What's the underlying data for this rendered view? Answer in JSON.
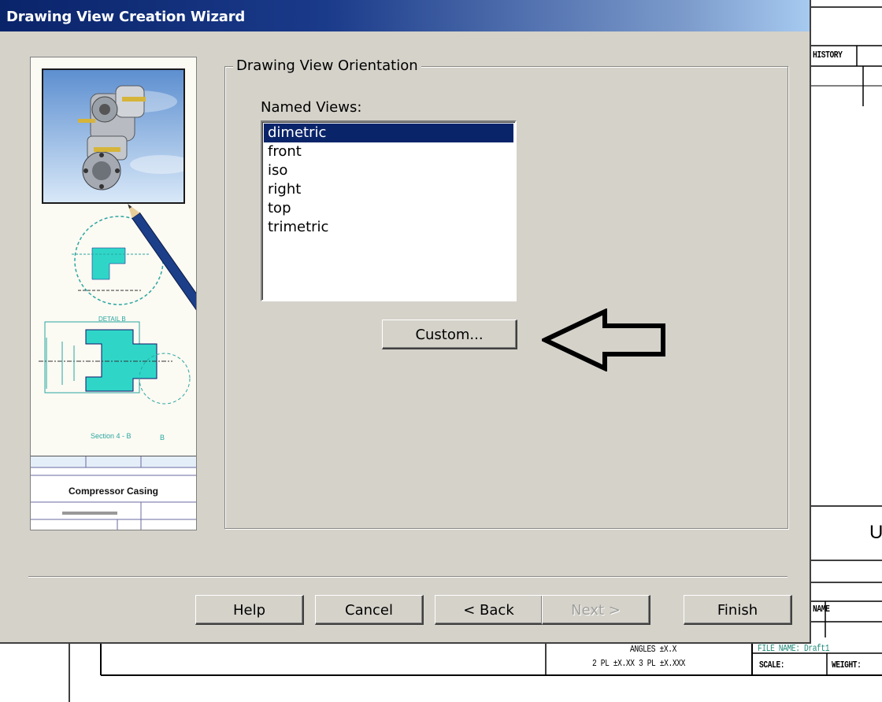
{
  "window": {
    "title": "Drawing View Creation Wizard"
  },
  "illustration": {
    "detail_label": "DETAIL B",
    "section_label": "Section 4 - B",
    "section_letter": "B",
    "titleblock_title": "Compressor Casing"
  },
  "group": {
    "legend": "Drawing View Orientation",
    "named_views_label": "Named Views:",
    "views": [
      "dimetric",
      "front",
      "iso",
      "right",
      "top",
      "trimetric"
    ],
    "selected": "dimetric",
    "custom_button": "Custom..."
  },
  "buttons": {
    "help": "Help",
    "cancel": "Cancel",
    "back": "< Back",
    "next": "Next >",
    "finish": "Finish"
  },
  "background_sheet": {
    "history": "HISTORY",
    "letter_u": "U",
    "name": "NAME",
    "angles": "ANGLES ±X.X",
    "tolerance": "2 PL ±X.XX 3 PL ±X.XXX",
    "file_name": "FILE NAME: Draft1",
    "scale": "SCALE:",
    "weight": "WEIGHT:"
  },
  "colors": {
    "title_gradient_start": "#0a246a",
    "title_gradient_end": "#a6caf0",
    "dialog_face": "#d5d2ca",
    "selection": "#0a246a",
    "teal": "#2aa7a0"
  }
}
